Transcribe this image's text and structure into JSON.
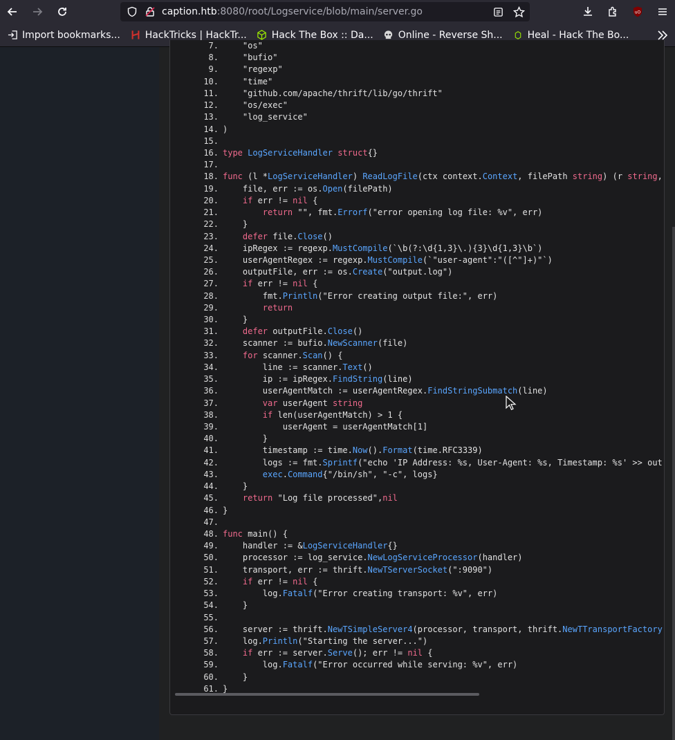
{
  "browser": {
    "url_host": "caption.htb",
    "url_rest": ":8080/root/Logservice/blob/main/server.go",
    "bookmarks": [
      {
        "label": "Import bookmarks...",
        "icon": "import-icon"
      },
      {
        "label": "HackTricks | HackTr...",
        "icon": "hacktricks-icon"
      },
      {
        "label": "Hack The Box :: Da...",
        "icon": "htb-cube-icon"
      },
      {
        "label": "Online - Reverse Sh...",
        "icon": "skull-icon"
      },
      {
        "label": "Heal - Hack The Bo...",
        "icon": "heal-icon"
      }
    ]
  },
  "code": {
    "lines": [
      {
        "n": "7.",
        "t": "    \"os\""
      },
      {
        "n": "8.",
        "t": "    \"bufio\""
      },
      {
        "n": "9.",
        "t": "    \"regexp\""
      },
      {
        "n": "10.",
        "t": "    \"time\""
      },
      {
        "n": "11.",
        "t": "    \"github.com/apache/thrift/lib/go/thrift\""
      },
      {
        "n": "12.",
        "t": "    \"os/exec\""
      },
      {
        "n": "13.",
        "t": "    \"log_service\""
      },
      {
        "n": "14.",
        "t": ")"
      },
      {
        "n": "15.",
        "t": ""
      },
      {
        "n": "16.",
        "t": "type LogServiceHandler struct{}"
      },
      {
        "n": "17.",
        "t": ""
      },
      {
        "n": "18.",
        "t": "func (l *LogServiceHandler) ReadLogFile(ctx context.Context, filePath string) (r string,"
      },
      {
        "n": "19.",
        "t": "    file, err := os.Open(filePath)"
      },
      {
        "n": "20.",
        "t": "    if err != nil {"
      },
      {
        "n": "21.",
        "t": "        return \"\", fmt.Errorf(\"error opening log file: %v\", err)"
      },
      {
        "n": "22.",
        "t": "    }"
      },
      {
        "n": "23.",
        "t": "    defer file.Close()"
      },
      {
        "n": "24.",
        "t": "    ipRegex := regexp.MustCompile(`\\b(?:\\d{1,3}\\.){3}\\d{1,3}\\b`)"
      },
      {
        "n": "25.",
        "t": "    userAgentRegex := regexp.MustCompile(`\"user-agent\":\"([^\"]+)\"`)"
      },
      {
        "n": "26.",
        "t": "    outputFile, err := os.Create(\"output.log\")"
      },
      {
        "n": "27.",
        "t": "    if err != nil {"
      },
      {
        "n": "28.",
        "t": "        fmt.Println(\"Error creating output file:\", err)"
      },
      {
        "n": "29.",
        "t": "        return"
      },
      {
        "n": "30.",
        "t": "    }"
      },
      {
        "n": "31.",
        "t": "    defer outputFile.Close()"
      },
      {
        "n": "32.",
        "t": "    scanner := bufio.NewScanner(file)"
      },
      {
        "n": "33.",
        "t": "    for scanner.Scan() {"
      },
      {
        "n": "34.",
        "t": "        line := scanner.Text()"
      },
      {
        "n": "35.",
        "t": "        ip := ipRegex.FindString(line)"
      },
      {
        "n": "36.",
        "t": "        userAgentMatch := userAgentRegex.FindStringSubmatch(line)"
      },
      {
        "n": "37.",
        "t": "        var userAgent string"
      },
      {
        "n": "38.",
        "t": "        if len(userAgentMatch) > 1 {"
      },
      {
        "n": "39.",
        "t": "            userAgent = userAgentMatch[1]"
      },
      {
        "n": "40.",
        "t": "        }"
      },
      {
        "n": "41.",
        "t": "        timestamp := time.Now().Format(time.RFC3339)"
      },
      {
        "n": "42.",
        "t": "        logs := fmt.Sprintf(\"echo 'IP Address: %s, User-Agent: %s, Timestamp: %s' >> out"
      },
      {
        "n": "43.",
        "t": "        exec.Command{\"/bin/sh\", \"-c\", logs}"
      },
      {
        "n": "44.",
        "t": "    }"
      },
      {
        "n": "45.",
        "t": "    return \"Log file processed\",nil"
      },
      {
        "n": "46.",
        "t": "}"
      },
      {
        "n": "47.",
        "t": ""
      },
      {
        "n": "48.",
        "t": "func main() {"
      },
      {
        "n": "49.",
        "t": "    handler := &LogServiceHandler{}"
      },
      {
        "n": "50.",
        "t": "    processor := log_service.NewLogServiceProcessor(handler)"
      },
      {
        "n": "51.",
        "t": "    transport, err := thrift.NewTServerSocket(\":9090\")"
      },
      {
        "n": "52.",
        "t": "    if err != nil {"
      },
      {
        "n": "53.",
        "t": "        log.Fatalf(\"Error creating transport: %v\", err)"
      },
      {
        "n": "54.",
        "t": "    }"
      },
      {
        "n": "55.",
        "t": ""
      },
      {
        "n": "56.",
        "t": "    server := thrift.NewTSimpleServer4(processor, transport, thrift.NewTTransportFactory"
      },
      {
        "n": "57.",
        "t": "    log.Println(\"Starting the server...\")"
      },
      {
        "n": "58.",
        "t": "    if err := server.Serve(); err != nil {"
      },
      {
        "n": "59.",
        "t": "        log.Fatalf(\"Error occurred while serving: %v\", err)"
      },
      {
        "n": "60.",
        "t": "    }"
      },
      {
        "n": "61.",
        "t": "}"
      }
    ]
  },
  "colors": {
    "keyword": "#f06a8d",
    "function": "#5aa6ff",
    "text": "#e2e2e2"
  }
}
